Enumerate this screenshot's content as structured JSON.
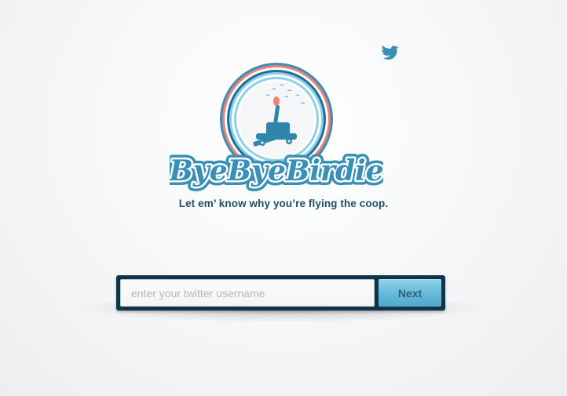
{
  "brand": {
    "name": "ByeByeBirdie",
    "tagline": "Let em’ know why you’re flying the coop."
  },
  "icons": {
    "bird": "twitter-bird-icon",
    "logo": "catapult-badge-logo"
  },
  "form": {
    "username_placeholder": "enter your twitter username",
    "username_value": "",
    "next_label": "Next"
  },
  "colors": {
    "primary_blue": "#3a8fb5",
    "light_blue": "#8ed0e6",
    "dark_navy": "#0f3347",
    "accent_coral": "#f07f78",
    "text_navy": "#1f4f6b"
  }
}
